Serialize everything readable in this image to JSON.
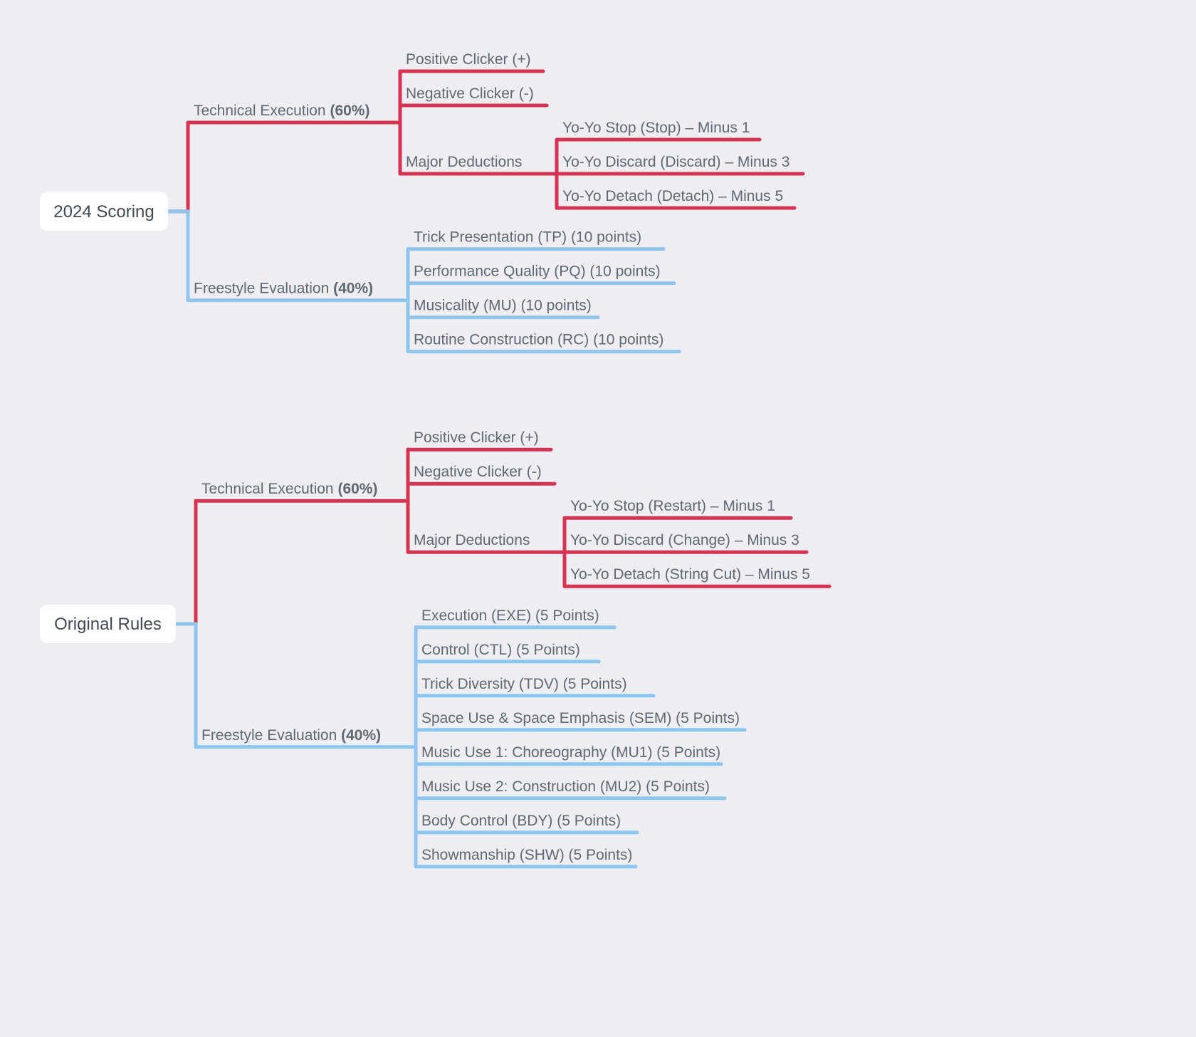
{
  "colors": {
    "red": "#d63353",
    "blue": "#90c5ef",
    "bg": "#eeeef2",
    "box": "#ffffff",
    "txt": "#5f6873",
    "boxTxt": "#414852"
  },
  "trees": [
    {
      "root": "2024 Scoring",
      "branches": [
        {
          "label": "Technical Execution ",
          "bold": "(60%)",
          "color": "red",
          "children": [
            {
              "label": "Positive Clicker (+)"
            },
            {
              "label": "Negative Clicker (-)"
            },
            {
              "label": "Major Deductions",
              "children": [
                {
                  "label": "Yo-Yo Stop (Stop) – Minus 1"
                },
                {
                  "label": "Yo-Yo Discard (Discard) – Minus 3"
                },
                {
                  "label": "Yo-Yo Detach (Detach) – Minus 5"
                }
              ]
            }
          ]
        },
        {
          "label": "Freestyle Evaluation ",
          "bold": "(40%)",
          "color": "blue",
          "children": [
            {
              "label": "Trick Presentation (TP) (10 points)"
            },
            {
              "label": "Performance Quality (PQ) (10 points)"
            },
            {
              "label": "Musicality (MU) (10 points)"
            },
            {
              "label": "Routine Construction (RC) (10 points)"
            }
          ]
        }
      ]
    },
    {
      "root": "Original Rules",
      "branches": [
        {
          "label": "Technical Execution ",
          "bold": "(60%)",
          "color": "red",
          "children": [
            {
              "label": "Positive Clicker (+)"
            },
            {
              "label": "Negative Clicker (-)"
            },
            {
              "label": "Major Deductions",
              "children": [
                {
                  "label": "Yo-Yo Stop (Restart) – Minus 1"
                },
                {
                  "label": "Yo-Yo Discard (Change) – Minus 3"
                },
                {
                  "label": "Yo-Yo Detach (String Cut) – Minus 5"
                }
              ]
            }
          ]
        },
        {
          "label": "Freestyle Evaluation ",
          "bold": "(40%)",
          "color": "blue",
          "children": [
            {
              "label": "Execution (EXE) (5 Points)"
            },
            {
              "label": "Control (CTL) (5 Points)"
            },
            {
              "label": "Trick Diversity (TDV) (5 Points)"
            },
            {
              "label": "Space Use & Space Emphasis (SEM) (5 Points)"
            },
            {
              "label": "Music Use 1: Choreography (MU1) (5 Points)"
            },
            {
              "label": "Music Use 2: Construction (MU2) (5 Points)"
            },
            {
              "label": "Body Control (BDY) (5 Points)"
            },
            {
              "label": "Showmanship (SHW) (5 Points)"
            }
          ]
        }
      ]
    }
  ],
  "chart_data": {
    "type": "tree",
    "description": "Mind-map comparing two yo-yo freestyle scoring rule sets",
    "nodes": [
      {
        "id": "2024",
        "label": "2024 Scoring",
        "children": [
          {
            "id": "2024-te",
            "label": "Technical Execution",
            "weight_pct": 60,
            "children": [
              {
                "label": "Positive Clicker (+)"
              },
              {
                "label": "Negative Clicker (-)"
              },
              {
                "label": "Major Deductions",
                "children": [
                  {
                    "label": "Yo-Yo Stop (Stop)",
                    "penalty": -1
                  },
                  {
                    "label": "Yo-Yo Discard (Discard)",
                    "penalty": -3
                  },
                  {
                    "label": "Yo-Yo Detach (Detach)",
                    "penalty": -5
                  }
                ]
              }
            ]
          },
          {
            "id": "2024-fe",
            "label": "Freestyle Evaluation",
            "weight_pct": 40,
            "children": [
              {
                "label": "Trick Presentation",
                "code": "TP",
                "points": 10
              },
              {
                "label": "Performance Quality",
                "code": "PQ",
                "points": 10
              },
              {
                "label": "Musicality",
                "code": "MU",
                "points": 10
              },
              {
                "label": "Routine Construction",
                "code": "RC",
                "points": 10
              }
            ]
          }
        ]
      },
      {
        "id": "orig",
        "label": "Original Rules",
        "children": [
          {
            "id": "orig-te",
            "label": "Technical Execution",
            "weight_pct": 60,
            "children": [
              {
                "label": "Positive Clicker (+)"
              },
              {
                "label": "Negative Clicker (-)"
              },
              {
                "label": "Major Deductions",
                "children": [
                  {
                    "label": "Yo-Yo Stop (Restart)",
                    "penalty": -1
                  },
                  {
                    "label": "Yo-Yo Discard (Change)",
                    "penalty": -3
                  },
                  {
                    "label": "Yo-Yo Detach (String Cut)",
                    "penalty": -5
                  }
                ]
              }
            ]
          },
          {
            "id": "orig-fe",
            "label": "Freestyle Evaluation",
            "weight_pct": 40,
            "children": [
              {
                "label": "Execution",
                "code": "EXE",
                "points": 5
              },
              {
                "label": "Control",
                "code": "CTL",
                "points": 5
              },
              {
                "label": "Trick Diversity",
                "code": "TDV",
                "points": 5
              },
              {
                "label": "Space Use & Space Emphasis",
                "code": "SEM",
                "points": 5
              },
              {
                "label": "Music Use 1: Choreography",
                "code": "MU1",
                "points": 5
              },
              {
                "label": "Music Use 2: Construction",
                "code": "MU2",
                "points": 5
              },
              {
                "label": "Body Control",
                "code": "BDY",
                "points": 5
              },
              {
                "label": "Showmanship",
                "code": "SHW",
                "points": 5
              }
            ]
          }
        ]
      }
    ]
  }
}
